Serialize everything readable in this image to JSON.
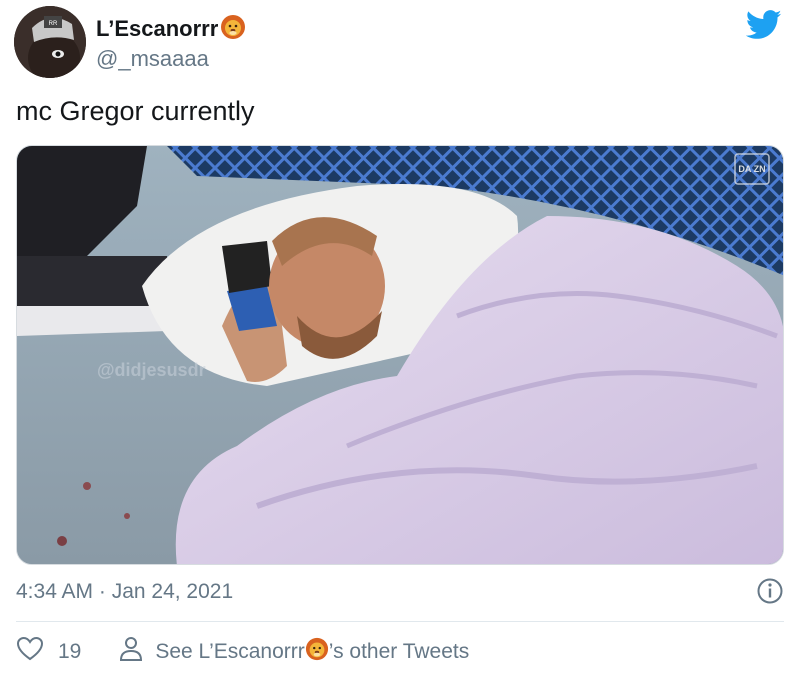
{
  "user": {
    "display_name": "L’Escanorrr",
    "handle": "@_msaaaa",
    "name_emoji": "lion-face-emoji"
  },
  "tweet": {
    "text": "mc Gregor currently",
    "media_alt": "photo of a man sleeping on a pillow under a lavender fleece blanket beside a cage fence",
    "media_watermark": "DA ZN",
    "media_handle_watermark": "@didjesusdr",
    "timestamp": "4:34 AM · Jan 24, 2021"
  },
  "actions": {
    "like_count": "19",
    "other_tweets_prefix": "See L’Escanorrr",
    "other_tweets_suffix": "’s other Tweets"
  },
  "icons": {
    "brand": "twitter-bird-icon",
    "info": "info-icon",
    "like": "heart-icon",
    "profile": "person-icon"
  },
  "colors": {
    "twitter_blue": "#1da1f2",
    "secondary_text": "#657786",
    "primary_text": "#14171a",
    "blanket": "#d9cde8"
  }
}
